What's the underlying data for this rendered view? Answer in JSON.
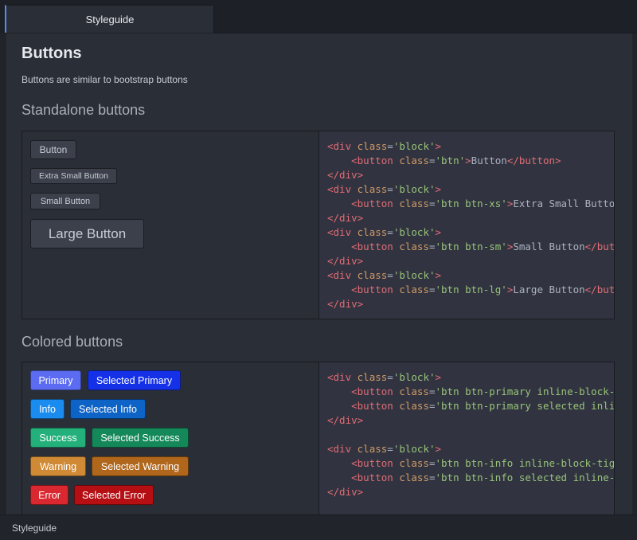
{
  "tab": {
    "title": "Styleguide"
  },
  "page": {
    "title": "Buttons",
    "description": "Buttons are similar to bootstrap buttons"
  },
  "standalone": {
    "heading": "Standalone buttons",
    "buttons": {
      "default": "Button",
      "xs": "Extra Small Button",
      "sm": "Small Button",
      "lg": "Large Button"
    },
    "code": [
      "<div class='block'>",
      "    <button class='btn'>Button</button>",
      "</div>",
      "<div class='block'>",
      "    <button class='btn btn-xs'>Extra Small Button</button>",
      "</div>",
      "<div class='block'>",
      "    <button class='btn btn-sm'>Small Button</button>",
      "</div>",
      "<div class='block'>",
      "    <button class='btn btn-lg'>Large Button</button>",
      "</div>"
    ]
  },
  "colored": {
    "heading": "Colored buttons",
    "buttons": {
      "primary": "Primary",
      "selected_primary": "Selected Primary",
      "info": "Info",
      "selected_info": "Selected Info",
      "success": "Success",
      "selected_success": "Selected Success",
      "warning": "Warning",
      "selected_warning": "Selected Warning",
      "error": "Error",
      "selected_error": "Selected Error"
    },
    "colors": {
      "primary": "#5b6cf2",
      "selected_primary": "#1431e8",
      "info": "#1a8cf0",
      "selected_info": "#0d63c6",
      "success": "#23b07a",
      "selected_success": "#15885a",
      "warning": "#d08a36",
      "selected_warning": "#b0661b",
      "error": "#d9282f",
      "selected_error": "#b50f14"
    },
    "code": [
      "<div class='block'>",
      "    <button class='btn btn-primary inline-block-tight'>Primary</button>",
      "    <button class='btn btn-primary selected inline-block-tight'>Selected Primary</button>",
      "</div>",
      "",
      "<div class='block'>",
      "    <button class='btn btn-info inline-block-tight'>Info</button>",
      "    <button class='btn btn-info selected inline-block-tight'>Selected Info</button>",
      "</div>"
    ]
  },
  "statusbar": {
    "text": "Styleguide"
  },
  "theme": {
    "accent": "#568af2",
    "code_tag": "#e06c75",
    "code_attr": "#d19a66",
    "code_string": "#98c379"
  }
}
